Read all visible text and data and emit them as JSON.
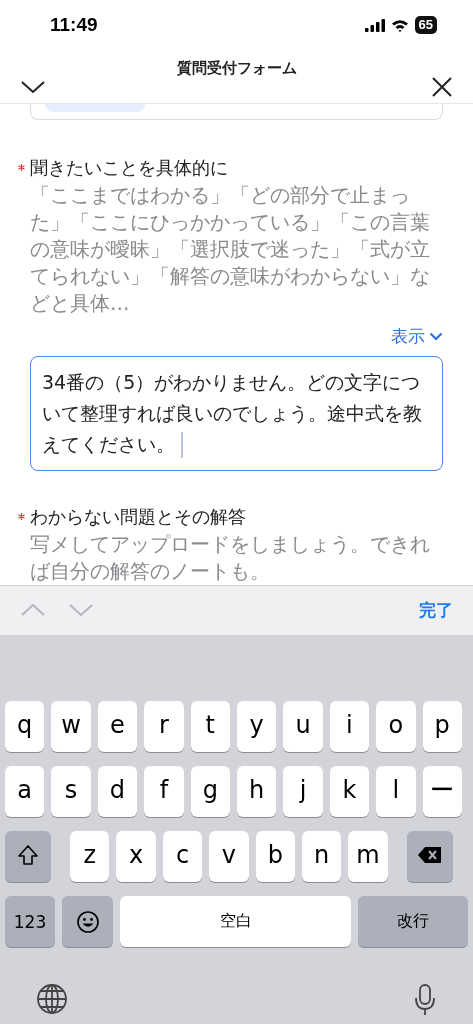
{
  "status_bar": {
    "time": "11:49",
    "battery": "65"
  },
  "nav_bar": {
    "title": "質問受付フォーム"
  },
  "fields": [
    {
      "label": "聞きたいことを具体的に",
      "required": true,
      "hint": "「ここまではわかる」「どの部分で止まった」「ここにひっかかっている」「この言葉の意味が曖昧」「選択肢で迷った」「式が立てられない」「解答の意味がわからない」などと具体…",
      "expand_link": "表示",
      "value": "34番の（5）がわかりません。どの文字について整理すれば良いのでしょう。途中式を教えてください。",
      "focused": true
    },
    {
      "label": "わからない問題とその解答",
      "required": true,
      "hint": "写メしてアップロードをしましょう。できれば自分の解答のノートも。"
    }
  ],
  "keyboard_toolbar": {
    "done": "完了"
  },
  "keyboard": {
    "rows": [
      [
        {
          "kind": "letter",
          "label": "q"
        },
        {
          "kind": "letter",
          "label": "w"
        },
        {
          "kind": "letter",
          "label": "e"
        },
        {
          "kind": "letter",
          "label": "r"
        },
        {
          "kind": "letter",
          "label": "t"
        },
        {
          "kind": "letter",
          "label": "y"
        },
        {
          "kind": "letter",
          "label": "u"
        },
        {
          "kind": "letter",
          "label": "i"
        },
        {
          "kind": "letter",
          "label": "o"
        },
        {
          "kind": "letter",
          "label": "p"
        }
      ],
      [
        {
          "kind": "letter",
          "label": "a"
        },
        {
          "kind": "letter",
          "label": "s"
        },
        {
          "kind": "letter",
          "label": "d"
        },
        {
          "kind": "letter",
          "label": "f"
        },
        {
          "kind": "letter",
          "label": "g"
        },
        {
          "kind": "letter",
          "label": "h"
        },
        {
          "kind": "letter",
          "label": "j"
        },
        {
          "kind": "letter",
          "label": "k"
        },
        {
          "kind": "letter",
          "label": "l"
        },
        {
          "kind": "letter",
          "label": "ー"
        }
      ],
      [
        {
          "kind": "shift"
        },
        {
          "kind": "letter",
          "label": "z"
        },
        {
          "kind": "letter",
          "label": "x"
        },
        {
          "kind": "letter",
          "label": "c"
        },
        {
          "kind": "letter",
          "label": "v"
        },
        {
          "kind": "letter",
          "label": "b"
        },
        {
          "kind": "letter",
          "label": "n"
        },
        {
          "kind": "letter",
          "label": "m"
        },
        {
          "kind": "delete"
        }
      ],
      [
        {
          "kind": "numbers",
          "label": "123"
        },
        {
          "kind": "emoji"
        },
        {
          "kind": "space",
          "label": "空白"
        },
        {
          "kind": "return",
          "label": "改行"
        }
      ]
    ]
  }
}
